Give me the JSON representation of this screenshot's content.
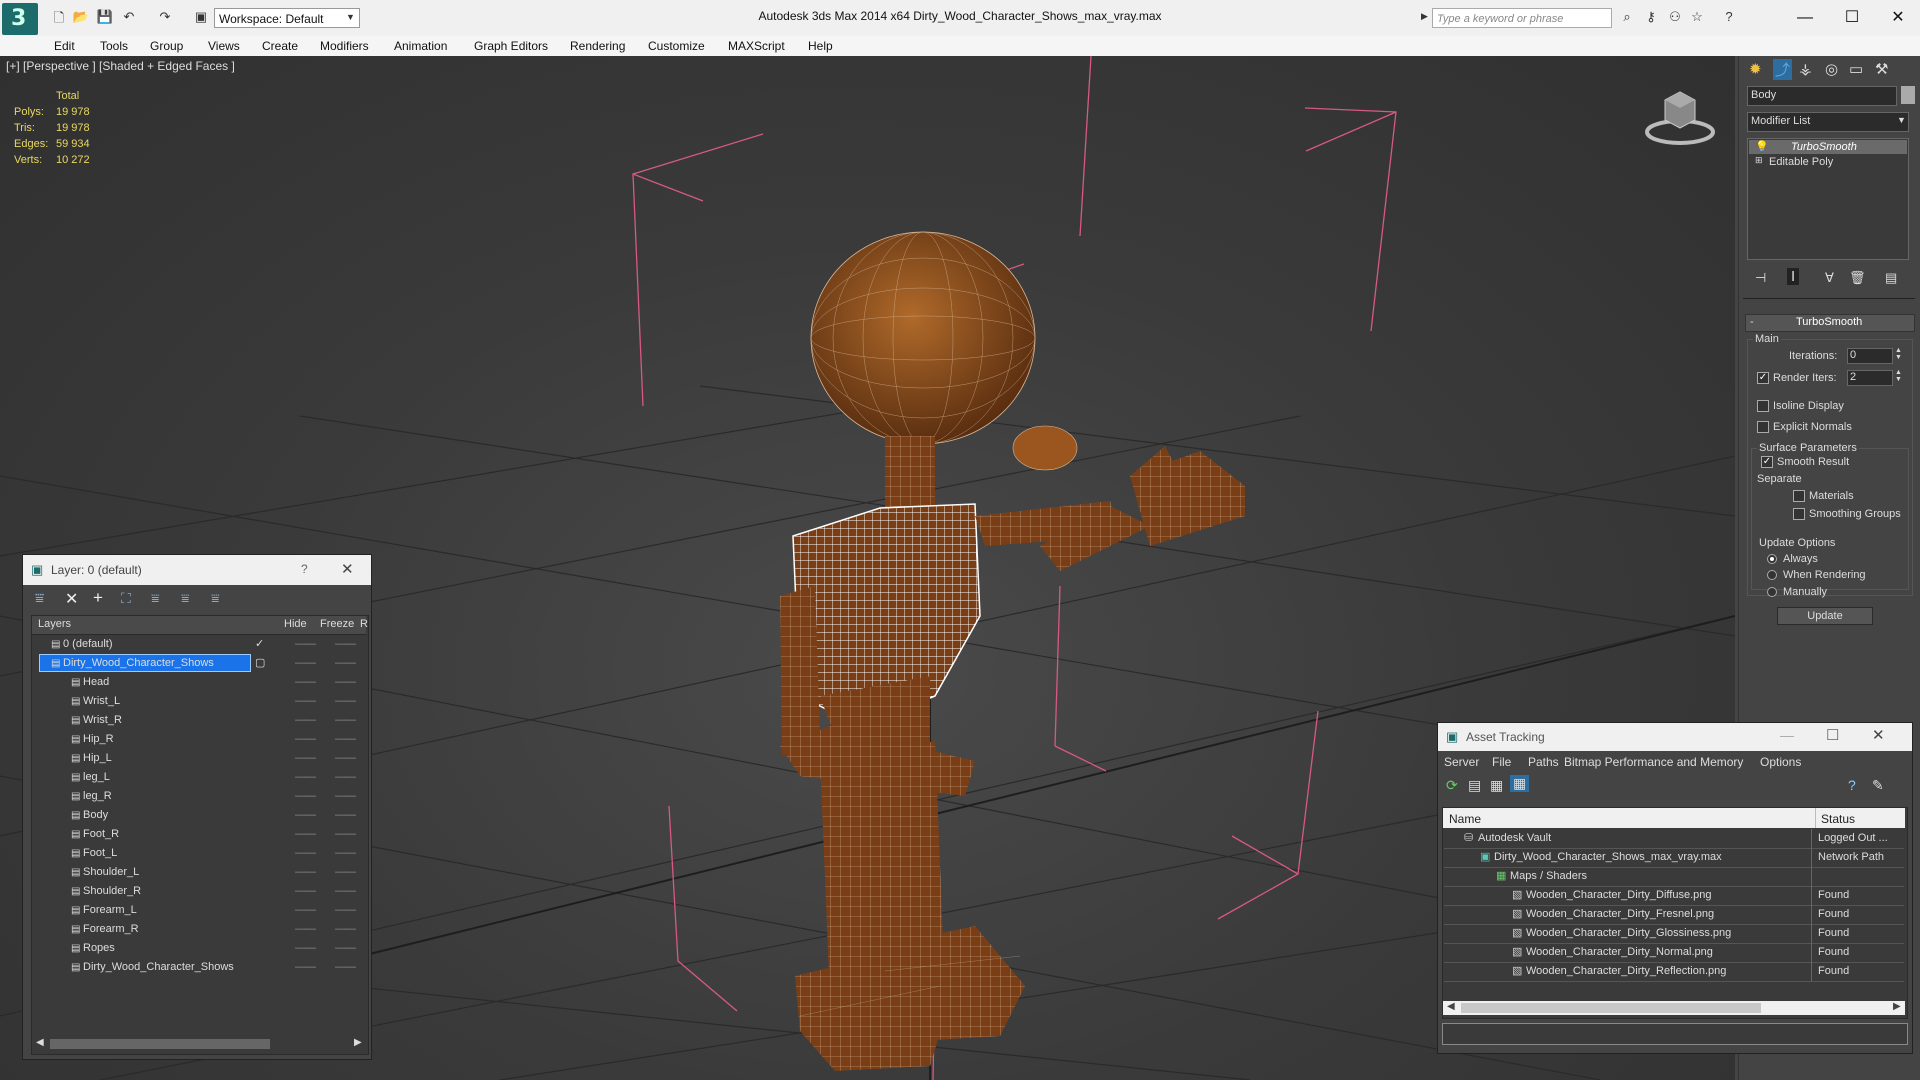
{
  "title_bar": {
    "workspace": "Workspace: Default",
    "app_title": "Autodesk 3ds Max  2014 x64      Dirty_Wood_Character_Shows_max_vray.max",
    "search_placeholder": "Type a keyword or phrase"
  },
  "menu": [
    "Edit",
    "Tools",
    "Group",
    "Views",
    "Create",
    "Modifiers",
    "Animation",
    "Graph Editors",
    "Rendering",
    "Customize",
    "MAXScript",
    "Help"
  ],
  "viewport": {
    "label": "[+] [Perspective ] [Shaded + Edged Faces ]",
    "stats": {
      "header": "Total",
      "rows": [
        {
          "label": "Polys:",
          "value": "19 978"
        },
        {
          "label": "Tris:",
          "value": "19 978"
        },
        {
          "label": "Edges:",
          "value": "59 934"
        },
        {
          "label": "Verts:",
          "value": "10 272"
        }
      ]
    }
  },
  "command_panel": {
    "object_name": "Body",
    "modifier_list": "Modifier List",
    "stack": [
      "TurboSmooth",
      "Editable Poly"
    ],
    "rollout_title": "TurboSmooth",
    "main_group": "Main",
    "iterations_label": "Iterations:",
    "iterations_value": "0",
    "render_iters_label": "Render Iters:",
    "render_iters_value": "2",
    "isoline_display": "Isoline Display",
    "explicit_normals": "Explicit Normals",
    "surface_params": "Surface Parameters",
    "smooth_result": "Smooth Result",
    "separate": "Separate",
    "materials": "Materials",
    "smoothing_groups": "Smoothing Groups",
    "update_options": "Update Options",
    "always": "Always",
    "when_rendering": "When Rendering",
    "manually": "Manually",
    "update_button": "Update"
  },
  "layer_window": {
    "title": "Layer: 0 (default)",
    "help": "?",
    "columns": {
      "layers": "Layers",
      "hide": "Hide",
      "freeze": "Freeze",
      "r": "R"
    },
    "rows": [
      {
        "name": "0 (default)",
        "level": 0
      },
      {
        "name": "Dirty_Wood_Character_Shows",
        "level": 0,
        "selected": true
      },
      {
        "name": "Head",
        "level": 1
      },
      {
        "name": "Wrist_L",
        "level": 1
      },
      {
        "name": "Wrist_R",
        "level": 1
      },
      {
        "name": "Hip_R",
        "level": 1
      },
      {
        "name": "Hip_L",
        "level": 1
      },
      {
        "name": "leg_L",
        "level": 1
      },
      {
        "name": "leg_R",
        "level": 1
      },
      {
        "name": "Body",
        "level": 1
      },
      {
        "name": "Foot_R",
        "level": 1
      },
      {
        "name": "Foot_L",
        "level": 1
      },
      {
        "name": "Shoulder_L",
        "level": 1
      },
      {
        "name": "Shoulder_R",
        "level": 1
      },
      {
        "name": "Forearm_L",
        "level": 1
      },
      {
        "name": "Forearm_R",
        "level": 1
      },
      {
        "name": "Ropes",
        "level": 1
      },
      {
        "name": "Dirty_Wood_Character_Shows",
        "level": 1
      }
    ],
    "dash": "——"
  },
  "asset_tracking": {
    "title": "Asset Tracking",
    "menu": [
      "Server",
      "File",
      "Paths",
      "Bitmap Performance and Memory",
      "Options"
    ],
    "columns": {
      "name": "Name",
      "status": "Status"
    },
    "rows": [
      {
        "name": "Autodesk Vault",
        "status": "Logged Out ...",
        "level": 0
      },
      {
        "name": "Dirty_Wood_Character_Shows_max_vray.max",
        "status": "Network Path",
        "level": 1
      },
      {
        "name": "Maps / Shaders",
        "status": "",
        "level": 2
      },
      {
        "name": "Wooden_Character_Dirty_Diffuse.png",
        "status": "Found",
        "level": 3
      },
      {
        "name": "Wooden_Character_Dirty_Fresnel.png",
        "status": "Found",
        "level": 3
      },
      {
        "name": "Wooden_Character_Dirty_Glossiness.png",
        "status": "Found",
        "level": 3
      },
      {
        "name": "Wooden_Character_Dirty_Normal.png",
        "status": "Found",
        "level": 3
      },
      {
        "name": "Wooden_Character_Dirty_Reflection.png",
        "status": "Found",
        "level": 3
      }
    ]
  },
  "colors": {
    "accent_select": "#1a73e8",
    "stats_yellow": "#e8d860",
    "bbox_pink": "#d65a80",
    "wood": "#8a4a1e"
  }
}
